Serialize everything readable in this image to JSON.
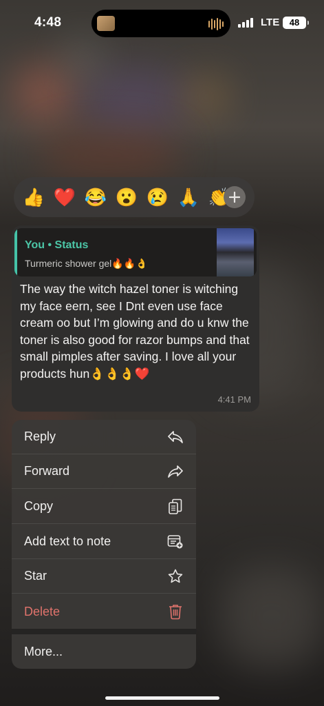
{
  "status_bar": {
    "time": "4:48",
    "network": "LTE",
    "battery": "48"
  },
  "reactions": {
    "items": [
      "👍",
      "❤️",
      "😂",
      "😮",
      "😢",
      "🙏",
      "👏"
    ],
    "more_icon": "plus-icon"
  },
  "message": {
    "quote_author": "You • Status",
    "quote_text": "Turmeric shower gel🔥🔥👌",
    "text": "The way the witch hazel toner is witching my face eern, see I Dnt even use face cream oo but I’m glowing and do u knw the toner is also good for razor bumps and that small pimples after saving. I love all your products hun👌👌👌❤️",
    "time": "4:41 PM"
  },
  "menu": {
    "reply": "Reply",
    "forward": "Forward",
    "copy": "Copy",
    "add_note": "Add text to note",
    "star": "Star",
    "delete": "Delete",
    "more": "More..."
  },
  "colors": {
    "accent": "#45c3a8",
    "danger": "#e0736c",
    "bubble": "#2f2e2d",
    "menu": "#3a3836"
  }
}
